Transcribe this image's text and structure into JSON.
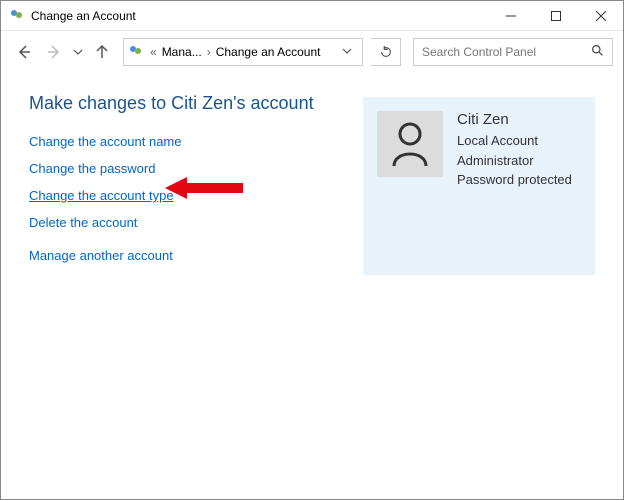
{
  "window": {
    "title": "Change an Account"
  },
  "breadcrumb": {
    "truncated": "Mana...",
    "current": "Change an Account"
  },
  "search": {
    "placeholder": "Search Control Panel"
  },
  "heading": "Make changes to Citi Zen's account",
  "links": {
    "change_name": "Change the account name",
    "change_password": "Change the password",
    "change_type": "Change the account type",
    "delete": "Delete the account",
    "manage_another": "Manage another account"
  },
  "account": {
    "name": "Citi Zen",
    "type": "Local Account",
    "role": "Administrator",
    "protection": "Password protected"
  }
}
